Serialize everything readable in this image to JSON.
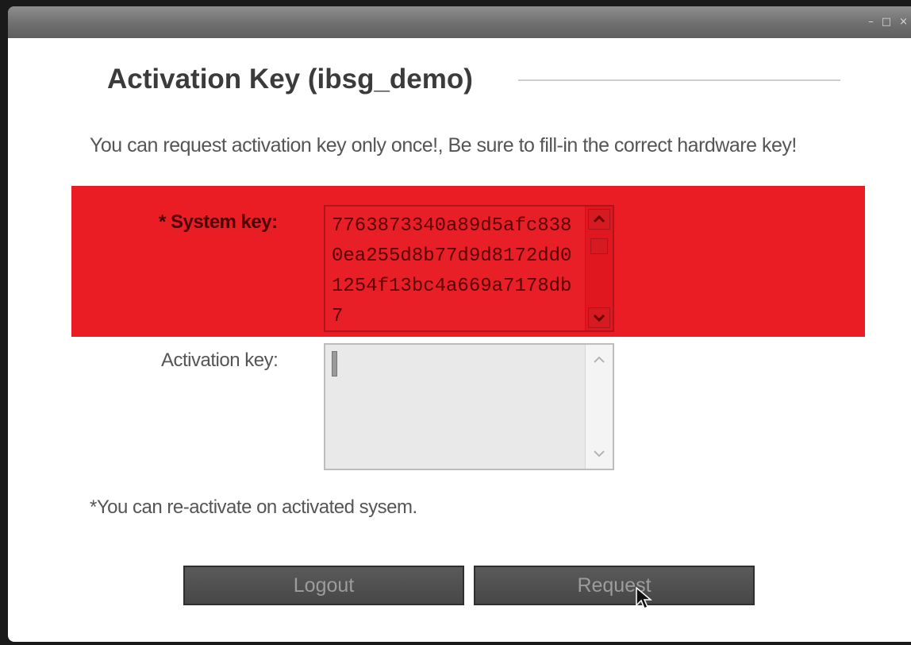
{
  "window": {
    "controls": {
      "minimize": "–",
      "maximize": "□",
      "close": "×"
    }
  },
  "dialog": {
    "title": "Activation Key (ibsg_demo)",
    "notice": "You can request activation key only once!, Be sure to fill-in the correct hardware key!",
    "system_key": {
      "label": "* System key:",
      "value": "7763873340a89d5afc8380ea255d8b77d9d8172dd01254f13bc4a669a7178db7"
    },
    "activation_key": {
      "label": "Activation key:",
      "value": ""
    },
    "footnote": "*You can re-activate on activated sysem.",
    "buttons": {
      "logout": "Logout",
      "request": "Request"
    }
  },
  "colors": {
    "highlight_band": "#ea1c24",
    "button_bg": "#4f4f4f",
    "titlebar": "#6f6f6f"
  },
  "icons": {
    "scroll_up": "chevron-up-icon",
    "scroll_down": "chevron-down-icon",
    "cursor": "mouse-pointer-icon"
  }
}
